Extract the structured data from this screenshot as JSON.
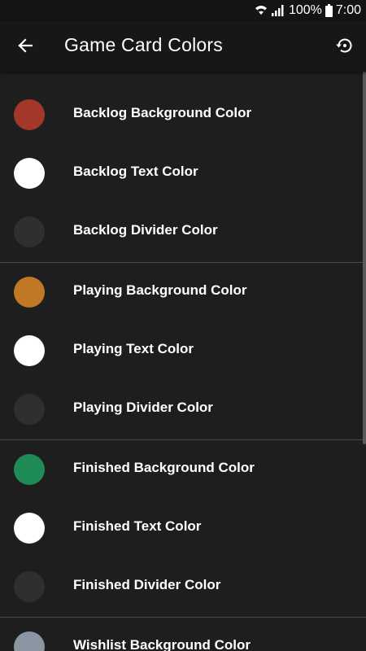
{
  "status_bar": {
    "battery_percent": "100%",
    "time": "7:00"
  },
  "app_bar": {
    "title": "Game Card Colors",
    "back_icon": "arrow-back-icon",
    "reset_icon": "restore-icon"
  },
  "sections": [
    {
      "name": "backlog",
      "items": [
        {
          "label": "Backlog Background Color",
          "color": "#a3372a"
        },
        {
          "label": "Backlog Text Color",
          "color": "#ffffff"
        },
        {
          "label": "Backlog Divider Color",
          "color": "#2f2f2f"
        }
      ]
    },
    {
      "name": "playing",
      "items": [
        {
          "label": "Playing Background Color",
          "color": "#c07825"
        },
        {
          "label": "Playing Text Color",
          "color": "#ffffff"
        },
        {
          "label": "Playing Divider Color",
          "color": "#2f2f2f"
        }
      ]
    },
    {
      "name": "finished",
      "items": [
        {
          "label": "Finished Background Color",
          "color": "#1e8a56"
        },
        {
          "label": "Finished Text Color",
          "color": "#ffffff"
        },
        {
          "label": "Finished Divider Color",
          "color": "#2f2f2f"
        }
      ]
    },
    {
      "name": "wishlist",
      "items": [
        {
          "label": "Wishlist Background Color",
          "color": "#8a96a2"
        }
      ]
    }
  ]
}
